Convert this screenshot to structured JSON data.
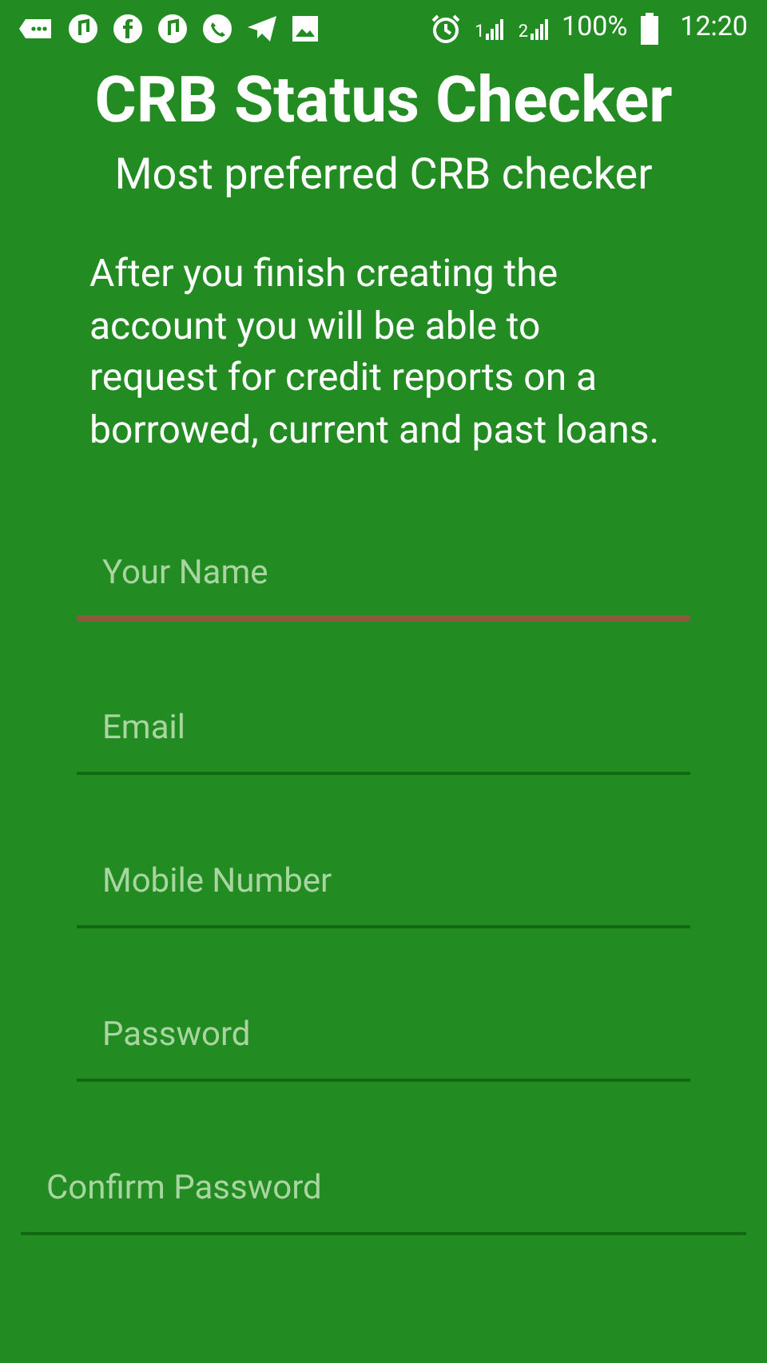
{
  "status_bar": {
    "sim_labels": [
      "1",
      "2"
    ],
    "battery": "100%",
    "time": "12:20"
  },
  "title": "CRB Status Checker",
  "subtitle": "Most preferred CRB checker",
  "intro": "After you finish creating the account you will be able to request for credit reports on a borrowed, current and past loans.",
  "fields": [
    {
      "placeholder": "Your Name",
      "focused": true,
      "inset": true
    },
    {
      "placeholder": "Email",
      "focused": false,
      "inset": true
    },
    {
      "placeholder": "Mobile Number",
      "focused": false,
      "inset": true
    },
    {
      "placeholder": "Password",
      "focused": false,
      "inset": true
    },
    {
      "placeholder": "Confirm Password",
      "focused": false,
      "inset": false
    }
  ]
}
